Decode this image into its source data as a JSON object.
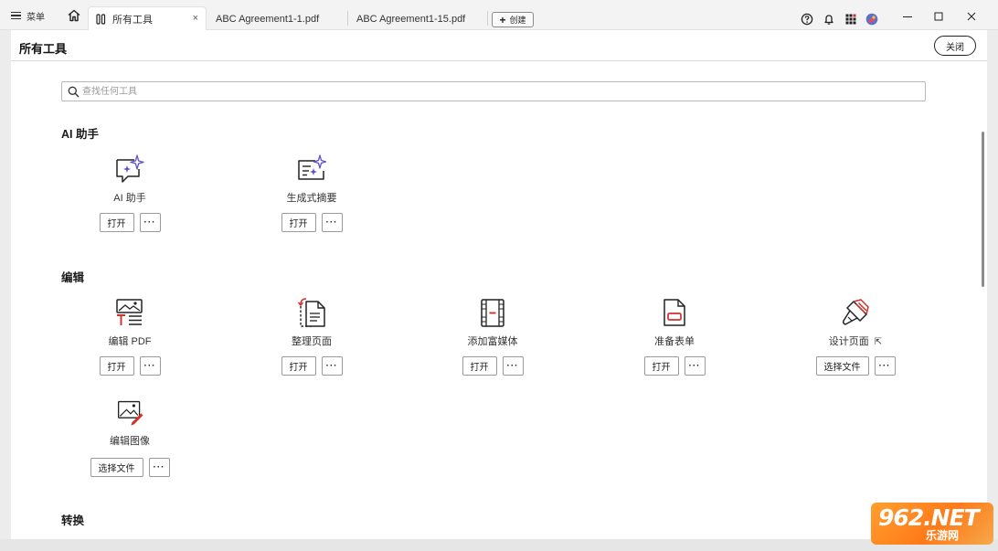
{
  "titlebar": {
    "menu_label": "菜单",
    "tabs": [
      {
        "label": "所有工具",
        "active": true,
        "close": "×"
      },
      {
        "label": "ABC Agreement1-1.pdf",
        "active": false
      },
      {
        "label": "ABC Agreement1-15.pdf",
        "active": false
      }
    ],
    "create_label": "创建",
    "icons": [
      "help-icon",
      "bell-icon",
      "apps-grid-icon",
      "avatar-icon"
    ],
    "window_controls": [
      "minimize-icon",
      "maximize-icon",
      "close-icon"
    ]
  },
  "header": {
    "title": "所有工具",
    "close_label": "关闭"
  },
  "search": {
    "placeholder": "查找任何工具"
  },
  "sections": {
    "ai": {
      "title": "AI 助手",
      "tools": [
        {
          "name": "AI 助手",
          "primary": "打开",
          "more": "···",
          "icon": "ai-chat-sparkle-icon"
        },
        {
          "name": "生成式摘要",
          "primary": "打开",
          "more": "···",
          "icon": "summary-sparkle-icon"
        }
      ]
    },
    "edit": {
      "title": "编辑",
      "tools": [
        {
          "name": "编辑 PDF",
          "primary": "打开",
          "more": "···",
          "icon": "edit-pdf-icon"
        },
        {
          "name": "整理页面",
          "primary": "打开",
          "more": "···",
          "icon": "organize-pages-icon"
        },
        {
          "name": "添加富媒体",
          "primary": "打开",
          "more": "···",
          "icon": "rich-media-icon"
        },
        {
          "name": "准备表单",
          "primary": "打开",
          "more": "···",
          "icon": "prepare-form-icon"
        },
        {
          "name": "设计页面",
          "primary": "选择文件",
          "more": "···",
          "icon": "design-brush-icon",
          "external": "⇱"
        },
        {
          "name": "编辑图像",
          "primary": "选择文件",
          "more": "···",
          "icon": "edit-image-icon"
        }
      ]
    },
    "convert": {
      "title": "转换"
    }
  },
  "watermark": {
    "big": "962.NET",
    "small": "乐游网"
  },
  "colors": {
    "accent_red": "#d0312d",
    "accent_purple": "#5b4fc7",
    "tab_active_bg": "#ffffff",
    "titlebar_bg": "#f3f3f3"
  }
}
